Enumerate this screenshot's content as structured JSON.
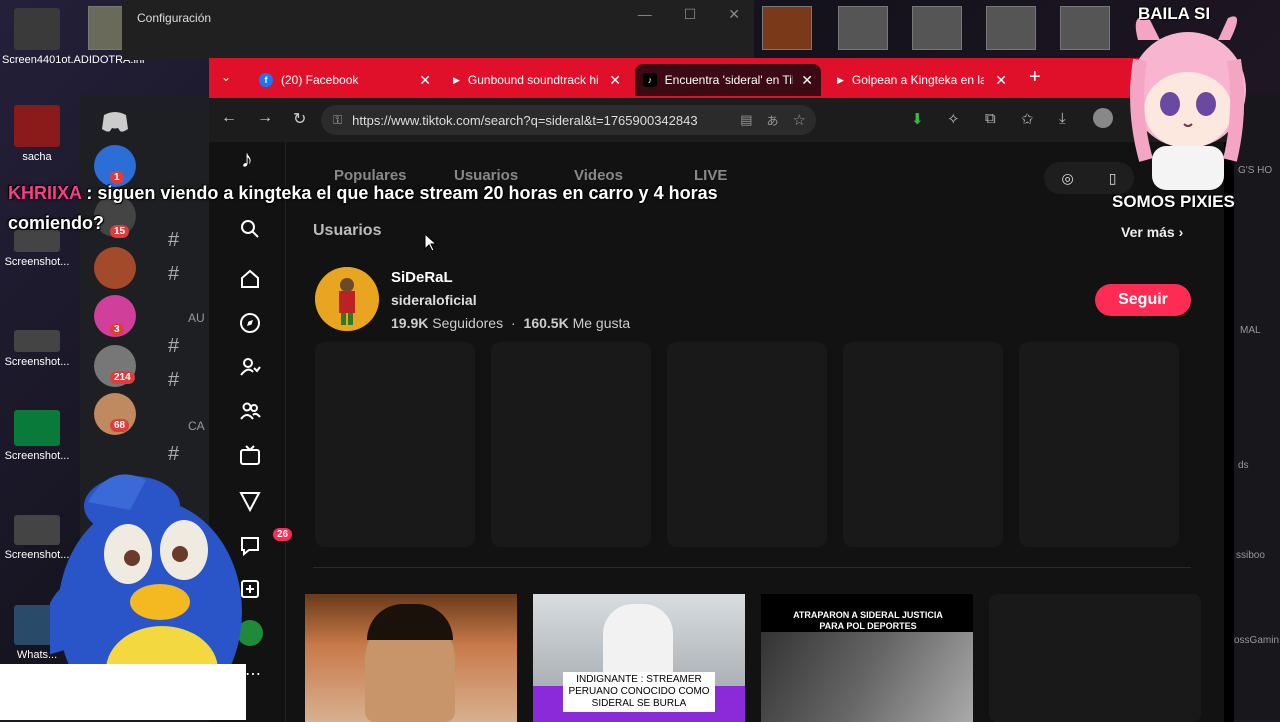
{
  "desktop": {
    "icons": [
      {
        "label": "Screen4401ot.ADIDOTRA.ini"
      },
      {
        "label": "sacha"
      },
      {
        "label": "Screenshot..."
      },
      {
        "label": "Screenshot..."
      },
      {
        "label": "Screenshot..."
      },
      {
        "label": "Screenshot..."
      },
      {
        "label": "Whats..."
      }
    ]
  },
  "settings_window": {
    "title": "Configuración",
    "minimize": "—",
    "maximize": "☐",
    "close": "✕"
  },
  "discord": {
    "badges": [
      "1",
      "15",
      "3",
      "214",
      "68"
    ],
    "categories": [
      "AU",
      "CA"
    ]
  },
  "browser": {
    "tabs": [
      {
        "title": "(20) Facebook",
        "favicon": "facebook-icon",
        "color": "#1877f2"
      },
      {
        "title": "Gunbound soundtrack hi",
        "favicon": "youtube-icon",
        "color": "#ff0000"
      },
      {
        "title": "Encuentra 'sideral' en Tik",
        "favicon": "tiktok-icon",
        "color": "#000000",
        "active": true
      },
      {
        "title": "Golpean a Kingteka en la",
        "favicon": "youtube-icon",
        "color": "#ff0000"
      }
    ],
    "new_tab": "+",
    "url": "https://www.tiktok.com/search?q=sideral&t=1765900342843",
    "accent_color": "#e0102a"
  },
  "tiktok": {
    "search_tabs": [
      "Populares",
      "Usuarios",
      "Videos",
      "LIVE"
    ],
    "section_title": "Usuarios",
    "see_more": "Ver más",
    "inbox_badge": "26",
    "user": {
      "name": "SiDeRaL",
      "handle": "sideraloficial",
      "followers": "19.9K",
      "followers_label": "Seguidores",
      "likes": "160.5K",
      "likes_label": "Me gusta",
      "follow_label": "Seguir"
    },
    "videos": [
      {
        "caption": ""
      },
      {
        "caption": "INDIGNANTE : STREAMER PERUANO CONOCIDO COMO SIDERAL SE BURLA"
      },
      {
        "caption": "ATRAPARON A SIDERAL JUSTICIA PARA POL DEPORTES"
      },
      {
        "caption": ""
      }
    ],
    "brand_color": "#fe2c55"
  },
  "chat_overlay": {
    "user": "KHRIIXA",
    "separator": " : ",
    "message": "siguen viendo a kingteka el que hace stream 20 horas en carro y 4 horas comiendo?"
  },
  "stream_overlay": {
    "top_text": "BAILA SI",
    "bottom_text": "SOMOS PIXIES"
  },
  "right_panel": {
    "labels": [
      "G'S HO",
      "MAL",
      "ds",
      "ssiboo",
      "ossGamin"
    ]
  }
}
